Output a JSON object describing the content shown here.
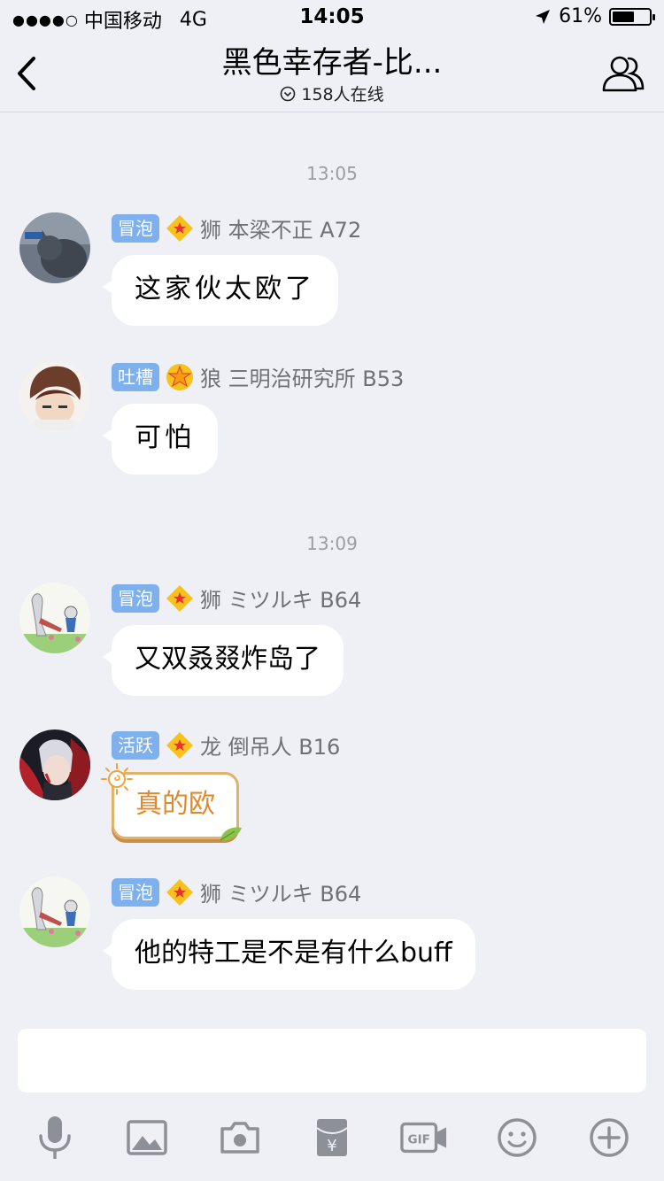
{
  "status_bar": {
    "signal_dots": "●●●●○",
    "carrier": "中国移动",
    "network": "4G",
    "time": "14:05",
    "battery": "61%",
    "battery_level": 0.61
  },
  "header": {
    "title": "黑色幸存者-比...",
    "online": "158人在线"
  },
  "timestamps": [
    "13:05",
    "13:09"
  ],
  "messages": [
    {
      "badge": "冒泡",
      "badge_color": "#7fb0ee",
      "rank_icon": "diamond-star-icon",
      "sender": "狮 本梁不正 A72",
      "text": "这家伙太欧了"
    },
    {
      "badge": "吐槽",
      "badge_color": "#7fb0ee",
      "rank_icon": "star-icon",
      "sender": "狼 三明治研究所 B53",
      "text": "可怕"
    },
    {
      "badge": "冒泡",
      "badge_color": "#7fb0ee",
      "rank_icon": "diamond-star-icon",
      "sender": "狮 ミツルキ B64",
      "text": "又双叒叕炸岛了"
    },
    {
      "badge": "活跃",
      "badge_color": "#7fb0ee",
      "rank_icon": "diamond-star-icon",
      "sender": "龙 倒吊人 B16",
      "text": "真的欧"
    },
    {
      "badge": "冒泡",
      "badge_color": "#7fb0ee",
      "rank_icon": "diamond-star-icon",
      "sender": "狮 ミツルキ B64",
      "text": "他的特工是不是有什么buff"
    }
  ],
  "input": {
    "placeholder": ""
  },
  "toolbar": [
    "microphone-icon",
    "image-icon",
    "camera-icon",
    "red-packet-icon",
    "gif-icon",
    "emoji-icon",
    "add-icon"
  ],
  "colors": {
    "badge": "#7fb0ee",
    "background": "#eef0f5",
    "icon": "#8e9098",
    "special_bubble_text": "#e0892a"
  }
}
